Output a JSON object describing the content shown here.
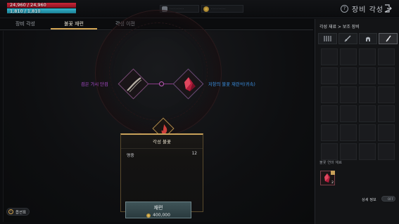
{
  "player": {
    "hp_text": "24,960 / 24,960",
    "hp_fraction": 1.0,
    "mp_text": "1,810 / 1,810",
    "mp_fraction": 1.0
  },
  "currency": {
    "items": [
      {
        "icon": "silver-token-icon",
        "value": "··········"
      },
      {
        "icon": "gold-coin-icon",
        "value": "··········"
      }
    ]
  },
  "header": {
    "title": "장비 각성",
    "help_icon": "question-icon",
    "exit_icon": "exit-icon"
  },
  "tabs": [
    {
      "label": "장비 각성",
      "active": false
    },
    {
      "label": "불꽃 재련",
      "active": true
    },
    {
      "label": "각성 이전",
      "active": false
    }
  ],
  "stage": {
    "left_label": "검은 가시 단검",
    "right_label": "저항의 불꽃 재련석(귀속)",
    "left_icon": "dagger-icon",
    "right_icon": "crystal-icon",
    "center_icon": "flame-icon"
  },
  "panel": {
    "title": "각성 불꽃",
    "rows": [
      {
        "label": "명중",
        "value": "12"
      }
    ]
  },
  "guide": {
    "label": "옵션표",
    "icon": "info-icon"
  },
  "refine": {
    "label": "재련",
    "cost": "400,000",
    "coin_icon": "gold-coin-icon"
  },
  "right_panel": {
    "breadcrumb": "각성 재료 > 보조 장비",
    "categories": [
      {
        "icon": "ring-set-icon",
        "active": false
      },
      {
        "icon": "sword-icon",
        "active": false
      },
      {
        "icon": "helmet-icon",
        "active": false
      },
      {
        "icon": "dagger-icon",
        "active": true
      }
    ],
    "grid_rows": 6,
    "grid_cols": 4,
    "materials_label": "불꽃 연마 재료",
    "material_icon": "crystal-icon",
    "material_count": "2",
    "detail_label": "상세 정보",
    "detail_toggle": "OFF"
  },
  "colors": {
    "accent_gold": "#c9a15a",
    "hp_red": "#c9283a",
    "mp_cyan": "#35b7cf",
    "left_label_purple": "#b34ed6",
    "right_label_blue": "#3b8fe0"
  }
}
